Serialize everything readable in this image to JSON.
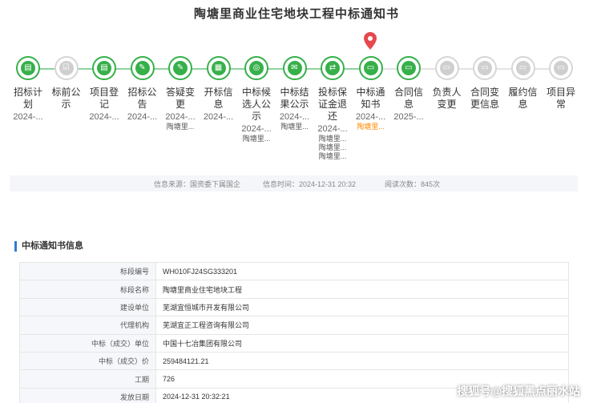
{
  "title": "陶塘里商业住宅地块工程中标通知书",
  "steps": [
    {
      "label": "招标计划",
      "date": "2024-...",
      "sub": [],
      "state": "done",
      "icon": "box-icon"
    },
    {
      "label": "标前公示",
      "date": "",
      "sub": [],
      "state": "todo",
      "icon": "checklist-icon"
    },
    {
      "label": "项目登记",
      "date": "2024-...",
      "sub": [],
      "state": "done",
      "icon": "box-icon"
    },
    {
      "label": "招标公告",
      "date": "2024-...",
      "sub": [],
      "state": "done",
      "icon": "edit-doc-icon"
    },
    {
      "label": "答疑变更",
      "date": "2024-...",
      "sub": [
        "陶塘里..."
      ],
      "state": "done",
      "icon": "edit-doc-icon"
    },
    {
      "label": "开标信息",
      "date": "2024-...",
      "sub": [],
      "state": "done",
      "icon": "calendar-icon"
    },
    {
      "label": "中标候选人公示",
      "date": "2024-...",
      "sub": [
        "陶塘里..."
      ],
      "state": "done",
      "icon": "target-icon"
    },
    {
      "label": "中标结果公示",
      "date": "2024-...",
      "sub": [
        "陶塘里..."
      ],
      "state": "done",
      "icon": "certificate-icon"
    },
    {
      "label": "投标保证金退还",
      "date": "2024-...",
      "sub": [
        "陶塘里...",
        "陶塘里...",
        "陶塘里..."
      ],
      "state": "done",
      "icon": "refund-icon"
    },
    {
      "label": "中标通知书",
      "date": "2024-...",
      "sub": [
        "陶塘里..."
      ],
      "state": "done",
      "icon": "folder-icon",
      "active": true
    },
    {
      "label": "合同信息",
      "date": "2025-...",
      "sub": [],
      "state": "done",
      "icon": "folder-icon"
    },
    {
      "label": "负责人变更",
      "date": "",
      "sub": [],
      "state": "todo",
      "icon": "folder-icon"
    },
    {
      "label": "合同变更信息",
      "date": "",
      "sub": [],
      "state": "todo",
      "icon": "folder-icon"
    },
    {
      "label": "履约信息",
      "date": "",
      "sub": [],
      "state": "todo",
      "icon": "folder-icon"
    },
    {
      "label": "项目异常",
      "date": "",
      "sub": [],
      "state": "todo",
      "icon": "folder-icon"
    }
  ],
  "info_bar": {
    "source": "信息来源：国资委下属国企",
    "time": "信息时间：2024-12-31 20:32",
    "views": "阅读次数：845次"
  },
  "section_title": "中标通知书信息",
  "details": [
    {
      "key": "标段编号",
      "value": "WH010FJ24SG333201"
    },
    {
      "key": "标段名称",
      "value": "陶塘里商业住宅地块工程"
    },
    {
      "key": "建设单位",
      "value": "芜湖宜恒城市开发有限公司"
    },
    {
      "key": "代理机构",
      "value": "芜湖宜正工程咨询有限公司"
    },
    {
      "key": "中标（成交）单位",
      "value": "中国十七冶集团有限公司"
    },
    {
      "key": "中标（成交）价",
      "value": "259484121.21"
    },
    {
      "key": "工期",
      "value": "726"
    },
    {
      "key": "发放日期",
      "value": "2024-12-31 20:32:21"
    }
  ],
  "watermark": "搜狐号@搜狐黑点丽水站",
  "colors": {
    "done": "#37b04a",
    "todo": "#cfcfcf",
    "accent": "#2f7bd8",
    "pin": "#e5484d",
    "highlight": "#ff8a00"
  }
}
